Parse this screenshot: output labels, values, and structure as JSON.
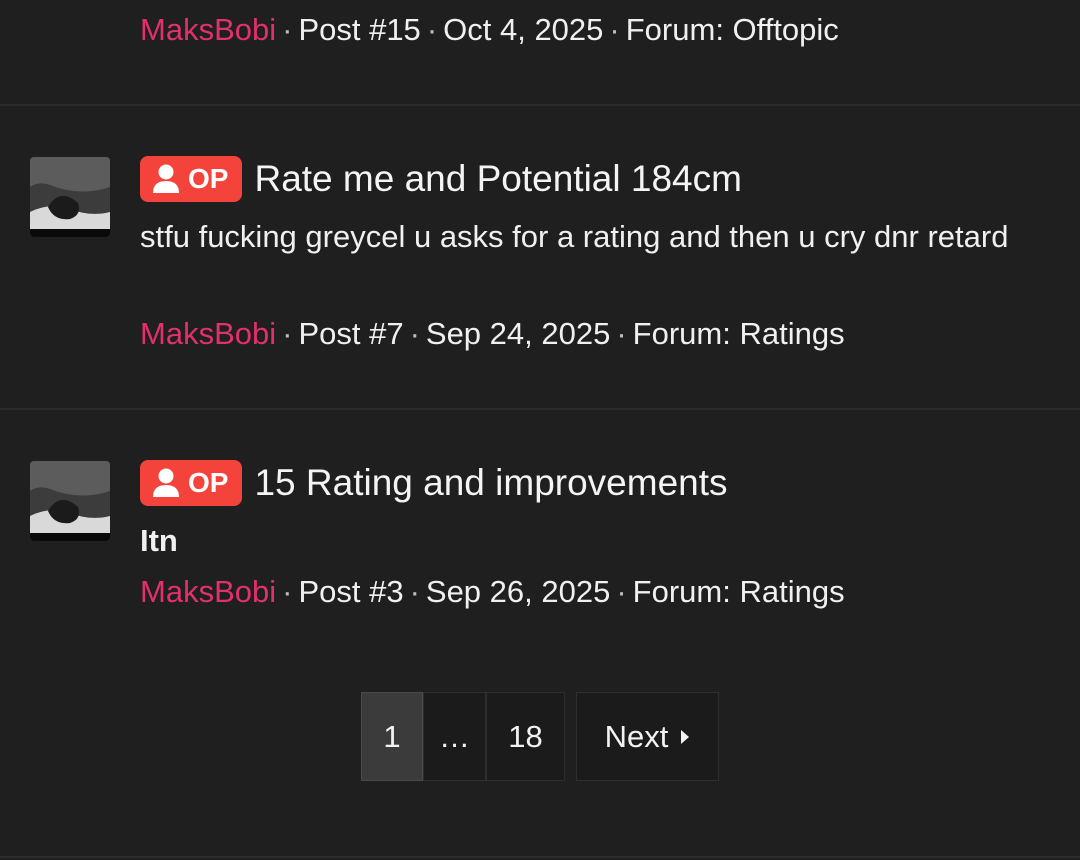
{
  "top_result": {
    "author": "MaksBobi",
    "post": "Post #15",
    "date": "Oct 4, 2025",
    "forum": "Forum: Offtopic"
  },
  "results": [
    {
      "badge": "OP",
      "title": "Rate me and Potential 184cm",
      "snippet": "stfu fucking greycel u asks for a rating and then u cry dnr retard",
      "author": "MaksBobi",
      "post": "Post #7",
      "date": "Sep 24, 2025",
      "forum": "Forum: Ratings"
    },
    {
      "badge": "OP",
      "title": "15 Rating and improvements",
      "snippet": "Itn",
      "author": "MaksBobi",
      "post": "Post #3",
      "date": "Sep 26, 2025",
      "forum": "Forum: Ratings"
    }
  ],
  "pagination": {
    "current": "1",
    "ellipsis": "…",
    "last": "18",
    "next_label": "Next"
  },
  "meta_separator": "·",
  "icons": {
    "user": "user-icon",
    "next": "caret-right-icon"
  },
  "colors": {
    "background": "#1f1f1f",
    "username": "#e0306f",
    "op_badge": "#f4433b"
  }
}
